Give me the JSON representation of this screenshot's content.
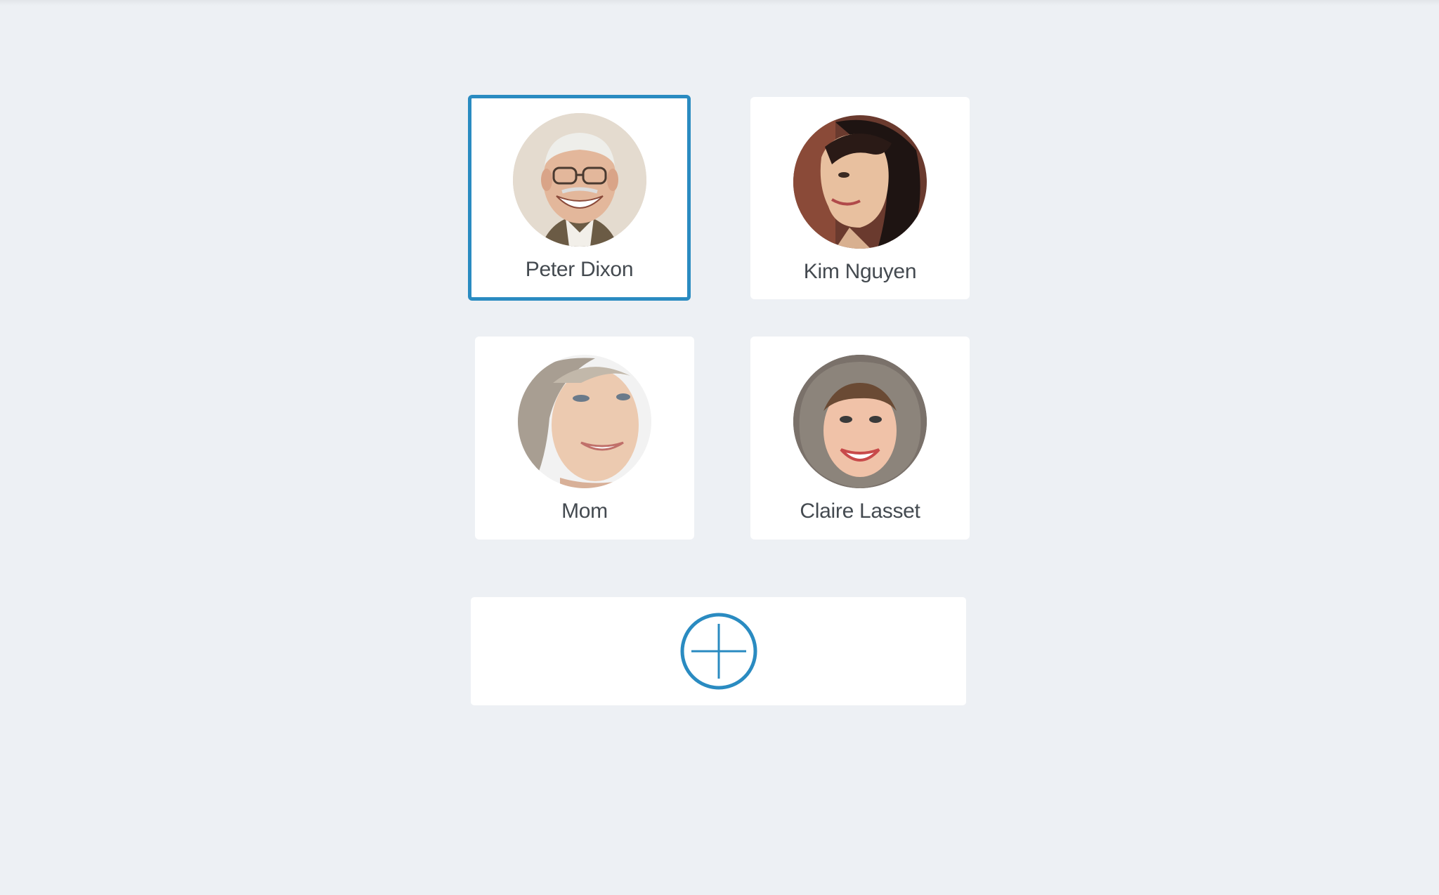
{
  "profiles": [
    {
      "name": "Peter Dixon",
      "selected": true,
      "avatar": "elderly-man-photo"
    },
    {
      "name": "Kim Nguyen",
      "selected": false,
      "avatar": "young-woman-photo"
    },
    {
      "name": "Mom",
      "selected": false,
      "avatar": "older-woman-photo"
    },
    {
      "name": "Claire Lasset",
      "selected": false,
      "avatar": "woman-fur-hood-photo"
    }
  ],
  "add_profile": {
    "icon": "plus-circle-icon"
  },
  "colors": {
    "background": "#edf0f4",
    "card": "#ffffff",
    "accent": "#2a8bc1",
    "text": "#444a50"
  }
}
